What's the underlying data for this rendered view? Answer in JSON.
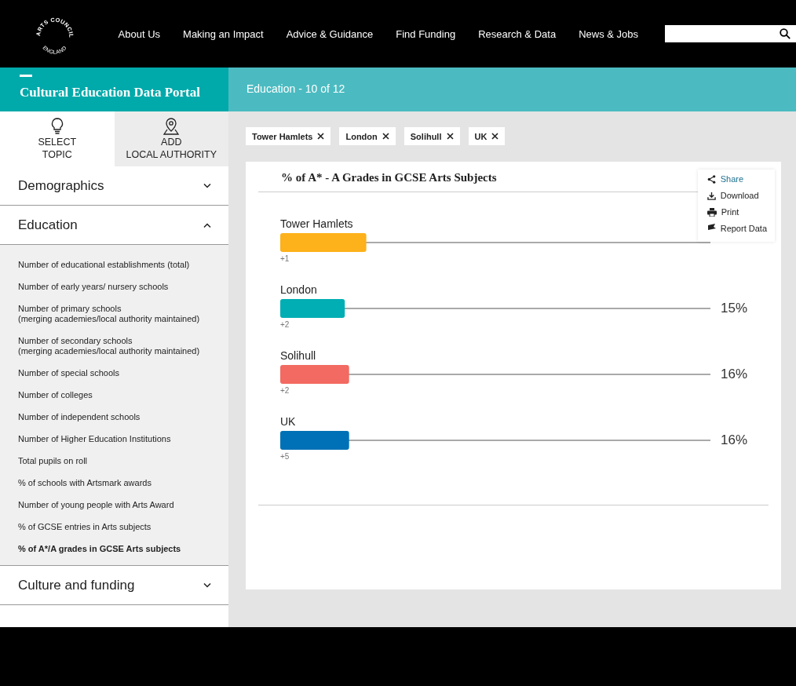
{
  "logo": {
    "top": "ARTS COUNCIL",
    "bottom": "ENGLAND"
  },
  "nav": [
    "About Us",
    "Making an Impact",
    "Advice & Guidance",
    "Find Funding",
    "Research & Data",
    "News & Jobs"
  ],
  "portal_title": "Cultural Education Data Portal",
  "breadcrumb": "Education - 10 of 12",
  "sidebar": {
    "tabs": [
      {
        "label_lines": [
          "SELECT",
          "TOPIC"
        ],
        "selected": true
      },
      {
        "label_lines": [
          "ADD",
          "LOCAL AUTHORITY"
        ],
        "selected": false
      }
    ],
    "sections": [
      {
        "title": "Demographics",
        "expanded": false
      },
      {
        "title": "Education",
        "expanded": true,
        "items": [
          {
            "label": "Number of educational establishments (total)",
            "selected": false
          },
          {
            "label": "Number of early years/ nursery schools",
            "selected": false
          },
          {
            "label": "Number of primary schools\n(merging academies/local authority maintained)",
            "selected": false
          },
          {
            "label": "Number of secondary schools\n(merging academies/local authority maintained)",
            "selected": false
          },
          {
            "label": "Number of special schools",
            "selected": false
          },
          {
            "label": "Number of colleges",
            "selected": false
          },
          {
            "label": "Number of independent schools",
            "selected": false
          },
          {
            "label": "Number of Higher Education Institutions",
            "selected": false
          },
          {
            "label": "Total pupils on roll",
            "selected": false
          },
          {
            "label": "% of schools with Artsmark awards",
            "selected": false
          },
          {
            "label": "Number of young people with Arts Award",
            "selected": false
          },
          {
            "label": "% of GCSE entries in Arts subjects",
            "selected": false
          },
          {
            "label": "% of A*/A grades in GCSE Arts subjects",
            "selected": true
          }
        ]
      },
      {
        "title": "Culture and funding",
        "expanded": false
      }
    ]
  },
  "filters": [
    "Tower Hamlets",
    "London",
    "Solihull",
    "UK"
  ],
  "chart": {
    "chart_data": {
      "type": "bar",
      "orientation": "horizontal",
      "title": "% of A* - A Grades in GCSE Arts Subjects",
      "categories": [
        "Tower Hamlets",
        "London",
        "Solihull",
        "UK"
      ],
      "values": [
        20,
        15,
        16,
        16
      ],
      "colors": [
        "#fdb11a",
        "#00aeb3",
        "#f26a61",
        "#0071b6"
      ],
      "xlim": [
        0,
        100
      ],
      "value_labels": [
        null,
        "15%",
        "16%",
        "16%"
      ],
      "annotations": [
        "+1",
        "+2",
        "+2",
        "+5"
      ]
    }
  },
  "menu": [
    {
      "label": "Share",
      "selected": true
    },
    {
      "label": "Download",
      "selected": false
    },
    {
      "label": "Print",
      "selected": false
    },
    {
      "label": "Report Data",
      "selected": false
    }
  ]
}
